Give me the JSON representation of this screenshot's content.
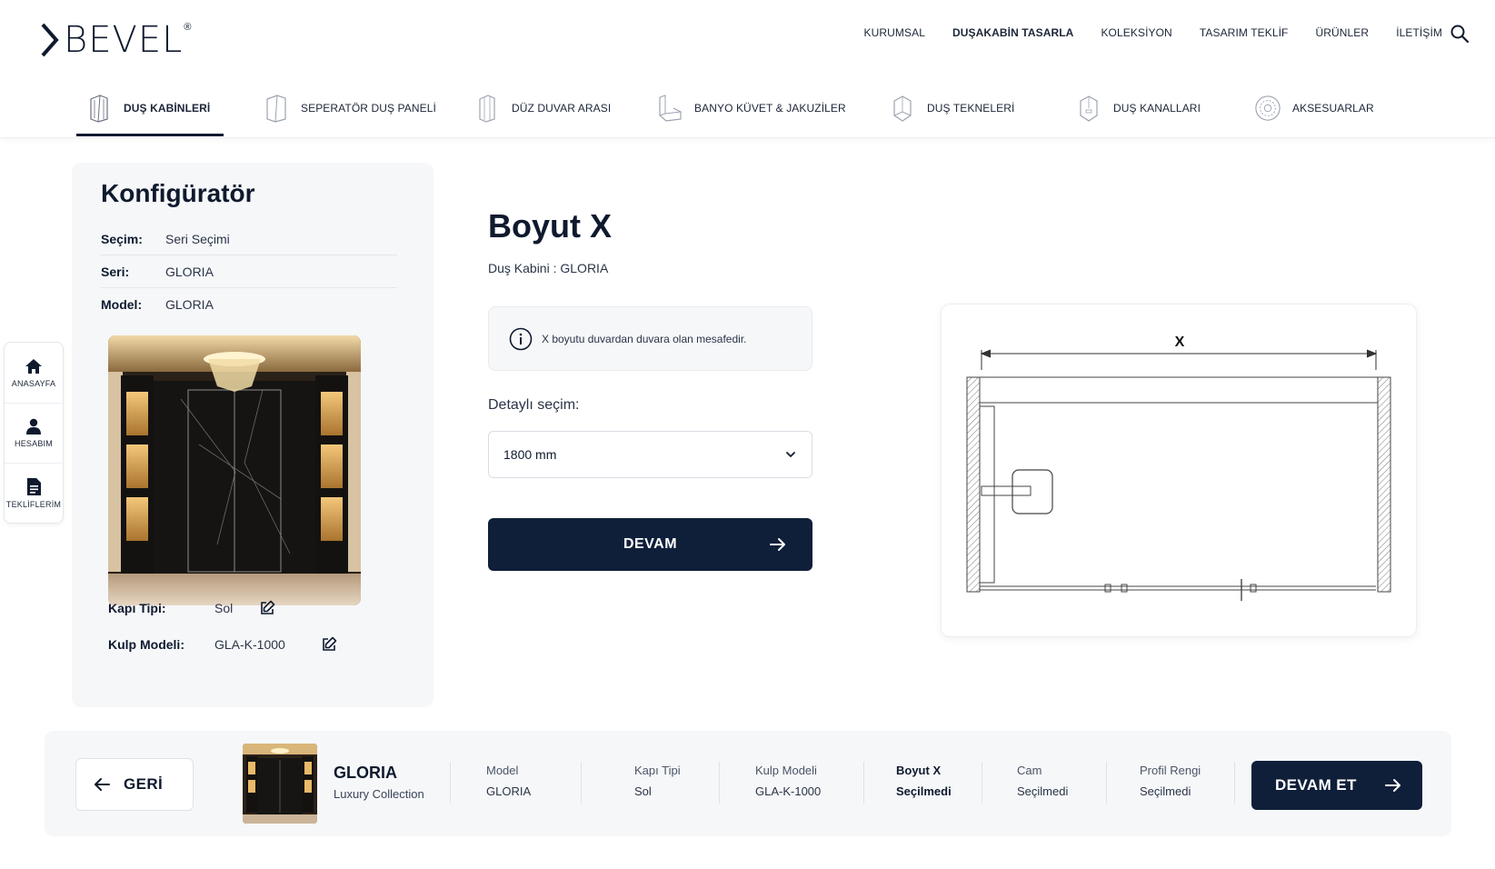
{
  "brand": {
    "name": "BEVEL",
    "registered": "®"
  },
  "topnav": [
    {
      "label": "KURUMSAL",
      "bold": false
    },
    {
      "label": "DUŞAKABİN TASARLA",
      "bold": true
    },
    {
      "label": "KOLEKSİYON",
      "bold": false
    },
    {
      "label": "TASARIM TEKLİF",
      "bold": false
    },
    {
      "label": "ÜRÜNLER",
      "bold": false
    },
    {
      "label": "İLETİŞİM",
      "bold": false
    }
  ],
  "categories": [
    {
      "label": "DUŞ KABİNLERİ",
      "icon": "shower-cabin-icon",
      "active": true
    },
    {
      "label": "SEPERATÖR DUŞ PANELİ",
      "icon": "separator-panel-icon",
      "active": false
    },
    {
      "label": "DÜZ DUVAR ARASI",
      "icon": "wall-to-wall-icon",
      "active": false
    },
    {
      "label": "BANYO KÜVET & JAKUZİLER",
      "icon": "bathtub-icon",
      "active": false
    },
    {
      "label": "DUŞ TEKNELERİ",
      "icon": "shower-tray-icon",
      "active": false
    },
    {
      "label": "DUŞ KANALLARI",
      "icon": "shower-drain-icon",
      "active": false
    },
    {
      "label": "AKSESUARLAR",
      "icon": "accessories-icon",
      "active": false
    }
  ],
  "dock": [
    {
      "label": "ANASAYFA",
      "icon": "home-icon"
    },
    {
      "label": "HESABIM",
      "icon": "user-icon"
    },
    {
      "label": "TEKLİFLERİM",
      "icon": "document-icon"
    }
  ],
  "configurator": {
    "title": "Konfigüratör",
    "specs": [
      {
        "key": "Seçim:",
        "value": "Seri Seçimi"
      },
      {
        "key": "Seri:",
        "value": "GLORIA"
      },
      {
        "key": "Model:",
        "value": "GLORIA"
      }
    ],
    "options": [
      {
        "key": "Kapı Tipi:",
        "value": "Sol"
      },
      {
        "key": "Kulp Modeli:",
        "value": "GLA-K-1000"
      }
    ]
  },
  "main": {
    "title": "Boyut X",
    "subtitle": "Duş Kabini : GLORIA",
    "info": "X boyutu duvardan duvara olan mesafedir.",
    "detail_label": "Detaylı seçim:",
    "selected_size": "1800 mm",
    "continue_label": "DEVAM"
  },
  "diagram": {
    "dimension_label": "X"
  },
  "footer": {
    "back_label": "GERİ",
    "product_name": "GLORIA",
    "collection": "Luxury Collection",
    "steps": [
      {
        "label": "Model",
        "value": "GLORIA",
        "current": false
      },
      {
        "label": "Kapı Tipi",
        "value": "Sol",
        "current": false
      },
      {
        "label": "Kulp Modeli",
        "value": "GLA-K-1000",
        "current": false
      },
      {
        "label": "Boyut X",
        "value": "Seçilmedi",
        "current": true
      },
      {
        "label": "Cam",
        "value": "Seçilmedi",
        "current": false
      },
      {
        "label": "Profil Rengi",
        "value": "Seçilmedi",
        "current": false
      }
    ],
    "next_label": "DEVAM ET"
  },
  "colors": {
    "primary": "#0f1f3a",
    "panel": "#f6f7f9",
    "text": "#0f1a2e"
  }
}
